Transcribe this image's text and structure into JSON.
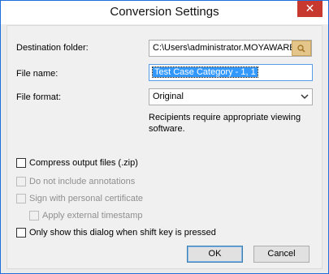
{
  "dialog": {
    "title": "Conversion Settings",
    "close_glyph": "✕"
  },
  "destination": {
    "label": "Destination folder:",
    "value": "C:\\Users\\administrator.MOYAWARE",
    "browse_icon": "search-folder-icon"
  },
  "filename": {
    "label": "File name:",
    "value": "Test Case Category - 1, 1"
  },
  "format": {
    "label": "File format:",
    "selected": "Original",
    "note": "Recipients require appropriate viewing software."
  },
  "options": {
    "compress": {
      "label": "Compress output files (.zip)",
      "checked": false,
      "enabled": true
    },
    "no_annotations": {
      "label": "Do not include annotations",
      "checked": false,
      "enabled": false
    },
    "sign": {
      "label": "Sign with personal certificate",
      "checked": false,
      "enabled": false
    },
    "timestamp": {
      "label": "Apply external timestamp",
      "checked": false,
      "enabled": false
    },
    "shift_only": {
      "label": "Only show this dialog when shift key is pressed",
      "checked": false,
      "enabled": true
    }
  },
  "buttons": {
    "ok": "OK",
    "cancel": "Cancel"
  },
  "colors": {
    "accent_border": "#1e6fd9",
    "close_red": "#c7382f",
    "selection_blue": "#3399ff"
  }
}
